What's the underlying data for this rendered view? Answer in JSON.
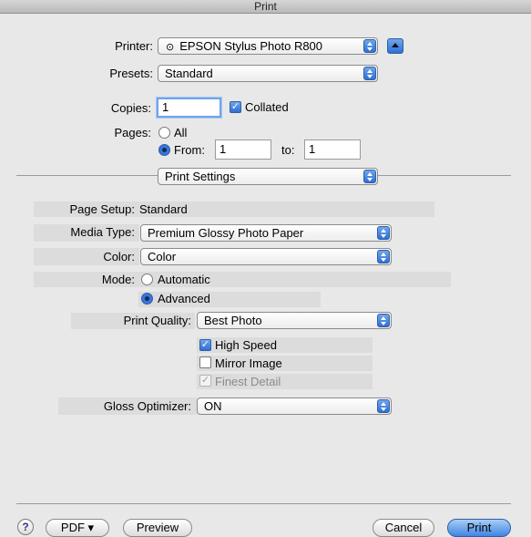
{
  "window": {
    "title": "Print"
  },
  "printer": {
    "label": "Printer:",
    "value": "EPSON Stylus Photo R800"
  },
  "presets": {
    "label": "Presets:",
    "value": "Standard"
  },
  "copies": {
    "label": "Copies:",
    "value": "1",
    "collated_label": "Collated",
    "collated": true
  },
  "pages": {
    "label": "Pages:",
    "all_label": "All",
    "from_label": "From:",
    "from_value": "1",
    "to_label": "to:",
    "to_value": "1",
    "selected": "from"
  },
  "panel": {
    "value": "Print Settings"
  },
  "settings": {
    "page_setup_label": "Page Setup:",
    "page_setup_value": "Standard",
    "media_type_label": "Media Type:",
    "media_type_value": "Premium Glossy Photo Paper",
    "color_label": "Color:",
    "color_value": "Color",
    "mode_label": "Mode:",
    "mode_automatic": "Automatic",
    "mode_advanced": "Advanced",
    "mode_selected": "advanced",
    "print_quality_label": "Print Quality:",
    "print_quality_value": "Best Photo",
    "high_speed_label": "High Speed",
    "high_speed": true,
    "mirror_image_label": "Mirror Image",
    "mirror_image": false,
    "finest_detail_label": "Finest Detail",
    "finest_detail": true,
    "gloss_optimizer_label": "Gloss Optimizer:",
    "gloss_optimizer_value": "ON"
  },
  "footer": {
    "help_label": "?",
    "pdf_label": "PDF ▾",
    "preview_label": "Preview",
    "cancel_label": "Cancel",
    "print_label": "Print"
  },
  "colors": {
    "accent": "#2f6fd6",
    "background": "#e8e8e8"
  }
}
